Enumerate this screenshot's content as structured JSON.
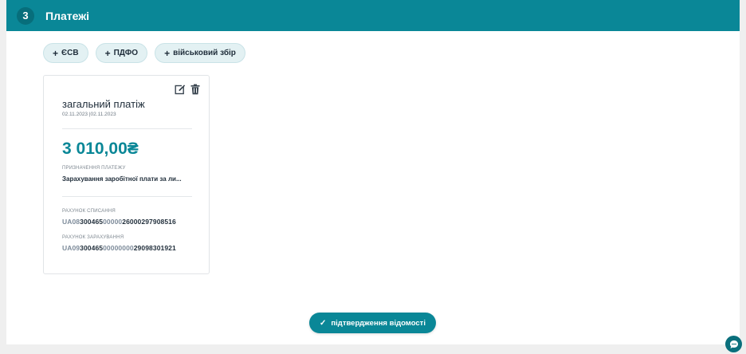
{
  "section": {
    "step": "3",
    "title": "Платежі"
  },
  "add_buttons": [
    {
      "plus": "+",
      "label": "ЄСВ"
    },
    {
      "plus": "+",
      "label": "ПДФО"
    },
    {
      "plus": "+",
      "label": "військовий збір"
    }
  ],
  "payment_card": {
    "title": "загальний платіж",
    "dates": "02.11.2023 |02.11.2023",
    "amount": "3 010,00₴",
    "purpose_label": "ПРИЗНАЧЕННЯ ПЛАТЕЖУ",
    "purpose": "Зарахування заробітної плати за ли...",
    "debit_label": "РАХУНОК СПИСАННЯ",
    "debit_iban": {
      "p1": "UA08",
      "p2": "300465",
      "p3": "00000",
      "p4": "26000297908516"
    },
    "credit_label": "РАХУНОК ЗАРАХУВАННЯ",
    "credit_iban": {
      "p1": "UA09",
      "p2": "300465",
      "p3": "00000000",
      "p4": "29098301921"
    },
    "icons": [
      "edit-icon",
      "trash-icon"
    ]
  },
  "confirm_button": {
    "check": "✓",
    "label": "підтвердження відомості"
  },
  "chat_icon": "chat-bubble-icon",
  "colors": {
    "accent": "#0a8797",
    "accent_dark": "#076e7b",
    "pill_bg": "#e3f1f3",
    "text": "#1f2d3a",
    "muted": "#7d8b9a"
  }
}
